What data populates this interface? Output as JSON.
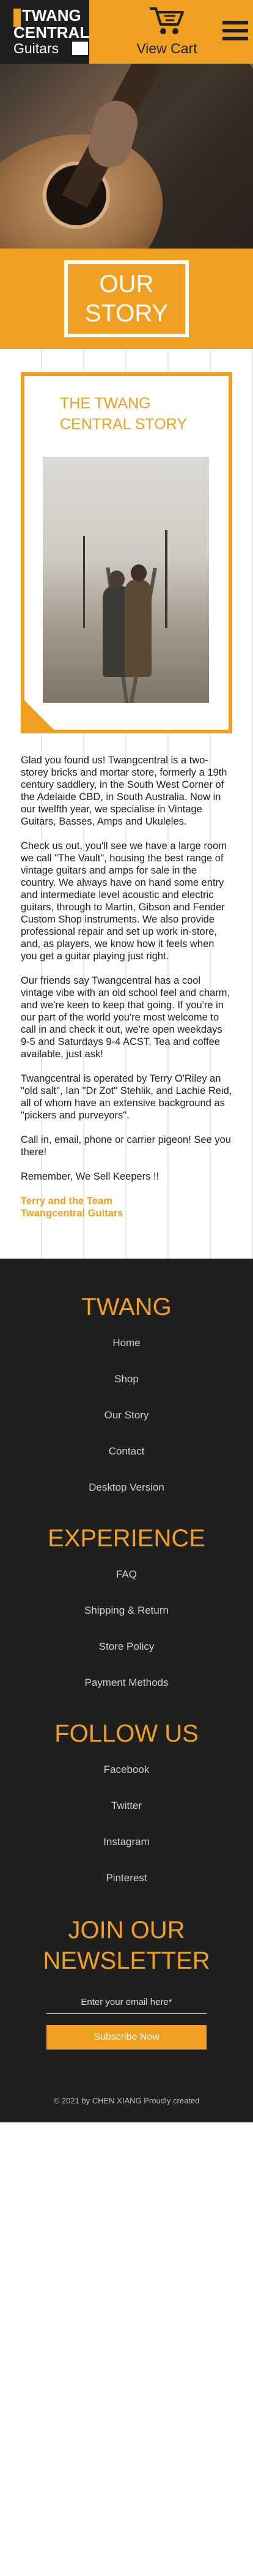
{
  "header": {
    "logo_line1": "TWANG",
    "logo_line2": "CENTRAL",
    "logo_line3": "Guitars",
    "cart_label": "View Cart"
  },
  "colors": {
    "accent": "#f0a020",
    "dark": "#1f1f1f"
  },
  "story_band": {
    "line1": "OUR",
    "line2": "STORY"
  },
  "card": {
    "title": "THE TWANG CENTRAL STORY"
  },
  "story": {
    "p1": "Glad you found us! Twangcentral is a two-storey bricks and mortar store, formerly a 19th century saddlery, in the South West Corner of the Adelaide CBD, in South Australia. Now in our twelfth year, we specialise in Vintage Guitars, Basses, Amps and Ukuleles.",
    "p2": "Check us out, you'll see we have a large room we call \"The Vault\", housing the best range of vintage guitars and amps for sale in the country.  We always have on hand some entry and intermediate level acoustic and electric guitars, through to Martin, Gibson and Fender Custom Shop instruments.  We also provide professional repair and set up work in-store, and, as players, we know how it feels when you get a guitar playing just right.",
    "p3": "Our friends say Twangcentral has a cool vintage vibe with an old school feel and charm, and we're keen to keep that going.  If you're in our part of the world you're most welcome to call in and check it out, we're open weekdays 9-5 and Saturdays 9-4 ACST.  Tea and coffee  available, just ask!",
    "p4": "Twangcentral is operated by Terry O'Riley an \"old salt\", Ian \"Dr Zot\" Stehlik, and Lachie Reid, all of whom have an extensive background  as \"pickers and purveyors\".",
    "p5": "Call in, email, phone or carrier pigeon! See you there!",
    "p6": "Remember, We Sell Keepers !!",
    "sign1": "Terry and the Team",
    "sign2": "Twangcentral Guitars"
  },
  "footer": {
    "twang": {
      "heading": "TWANG",
      "links": [
        "Home",
        "Shop",
        "Our Story",
        "Contact",
        "Desktop Version"
      ]
    },
    "experience": {
      "heading": "EXPERIENCE",
      "links": [
        "FAQ",
        "Shipping & Return",
        "Store Policy",
        "Payment Methods"
      ]
    },
    "follow": {
      "heading": "FOLLOW US",
      "links": [
        "Facebook",
        "Twitter",
        "Instagram",
        "Pinterest"
      ]
    },
    "newsletter": {
      "heading_line1": "JOIN OUR",
      "heading_line2": "NEWSLETTER",
      "email_placeholder": "Enter your email here*",
      "button_label": "Subscribe Now"
    },
    "copyright": "© 2021 by CHEN XIANG Proudly created"
  }
}
